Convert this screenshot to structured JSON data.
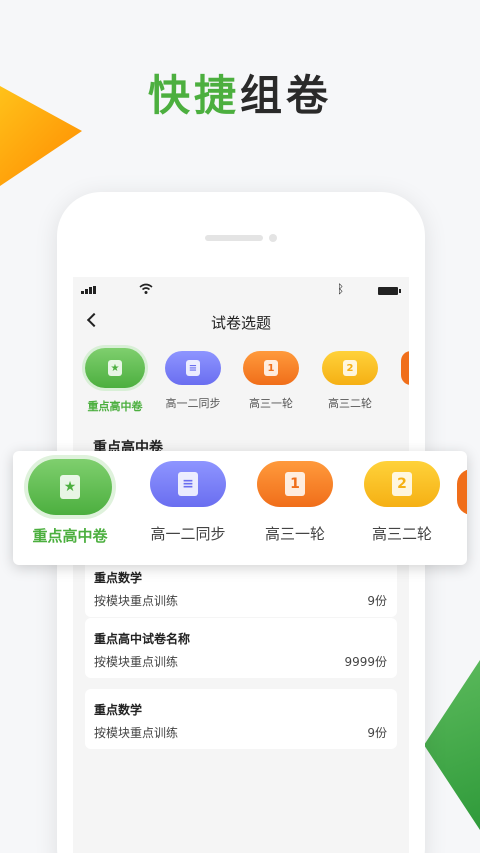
{
  "headline": {
    "part1": "快捷",
    "part2": "组卷"
  },
  "nav": {
    "title": "试卷选题"
  },
  "categories": [
    {
      "label": "重点高中卷",
      "icon": "star-doc-icon",
      "glyph": "★",
      "color": "green",
      "active": true
    },
    {
      "label": "高一二同步",
      "icon": "list-doc-icon",
      "glyph": "≡",
      "color": "purple",
      "active": false
    },
    {
      "label": "高三一轮",
      "icon": "number-1-doc-icon",
      "glyph": "1",
      "color": "orange",
      "active": false
    },
    {
      "label": "高三二轮",
      "icon": "number-2-doc-icon",
      "glyph": "2",
      "color": "yellow",
      "active": false
    }
  ],
  "section": {
    "title": "重点高中卷"
  },
  "papers": [
    {
      "name": "重点数学",
      "desc": "按模块重点训练",
      "count": "9份"
    },
    {
      "name": "重点高中试卷名称",
      "desc": "按模块重点训练",
      "count": "9999份"
    },
    {
      "name": "重点数学",
      "desc": "按模块重点训练",
      "count": "9份"
    }
  ],
  "colors": {
    "accent": "#4caf3f",
    "orange": "#f06e1a",
    "yellow": "#f5b014",
    "purple": "#6a6ef0"
  }
}
